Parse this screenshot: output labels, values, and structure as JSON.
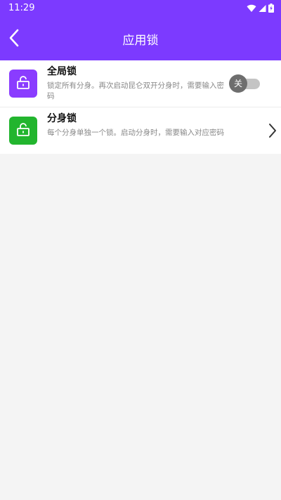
{
  "status_bar": {
    "time": "11:29",
    "icons": [
      "wifi-icon",
      "signal-icon",
      "battery-icon"
    ]
  },
  "app_bar": {
    "title": "应用锁",
    "back_icon": "back-arrow-icon"
  },
  "settings": [
    {
      "title": "全局锁",
      "description": "锁定所有分身。再次启动昆仑双开分身时，需要输入密码",
      "icon": "unlock-icon",
      "icon_color": "#8a3cff",
      "control": "toggle",
      "toggle_label": "关",
      "enabled": false
    },
    {
      "title": "分身锁",
      "description": "每个分身单独一个锁。启动分身时，需要输入对应密码",
      "icon": "unlock-icon",
      "icon_color": "#22b52e",
      "control": "chevron",
      "chevron_icon": "chevron-right-icon"
    }
  ],
  "colors": {
    "primary": "#7c3aff",
    "background": "#f4f4f4",
    "toggle_off_knob": "#6e6e6e",
    "toggle_off_track": "#c4c4c4"
  }
}
